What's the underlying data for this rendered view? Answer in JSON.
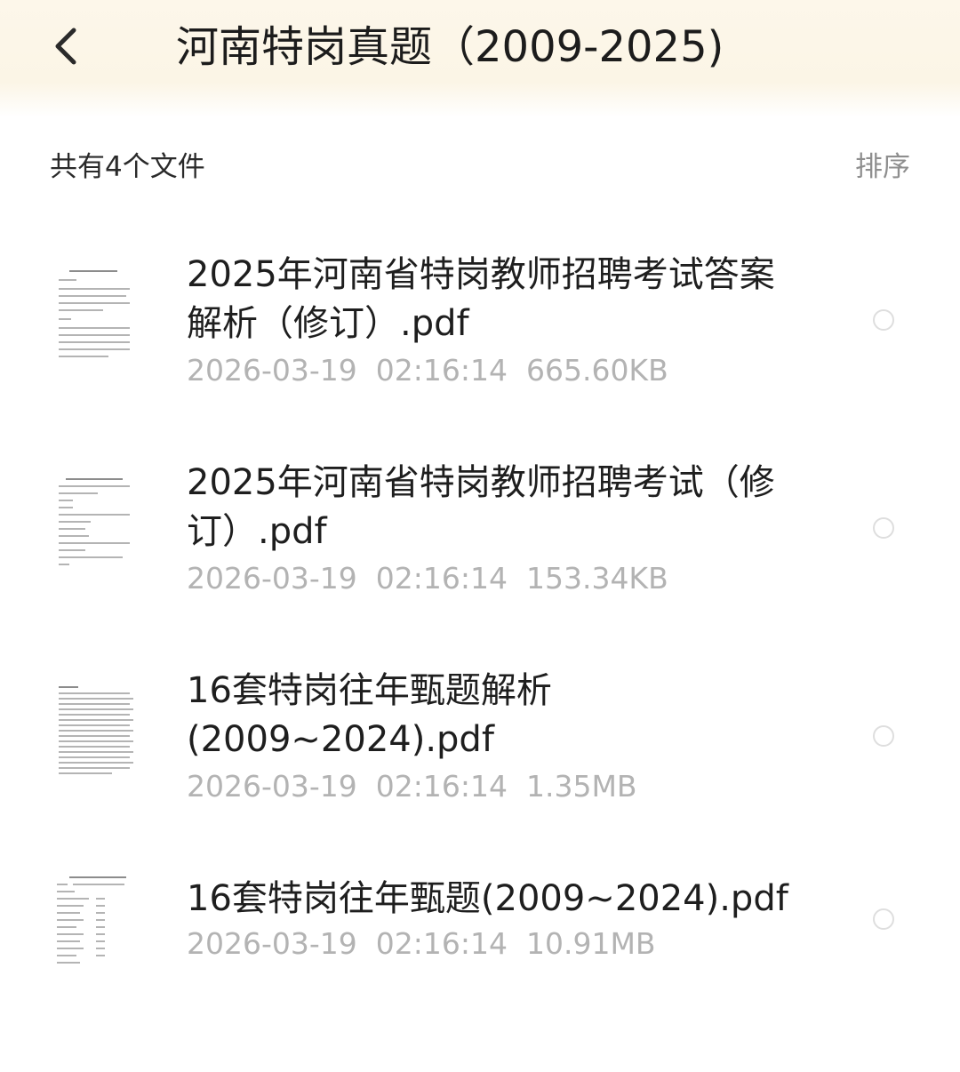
{
  "header": {
    "back_icon": "chevron-left-icon",
    "title": "河南特岗真题（2009-2025)"
  },
  "toolbar": {
    "count_label": "共有4个文件",
    "sort_label": "排序"
  },
  "files": [
    {
      "name": "2025年河南省特岗教师招聘考试答案解析（修订）.pdf",
      "date": "2026-03-19",
      "time": "02:16:14",
      "size": "665.60KB",
      "selected": false
    },
    {
      "name": "2025年河南省特岗教师招聘考试（修订）.pdf",
      "date": "2026-03-19",
      "time": "02:16:14",
      "size": "153.34KB",
      "selected": false
    },
    {
      "name": "16套特岗往年甄题解析(2009~2024).pdf",
      "date": "2026-03-19",
      "time": "02:16:14",
      "size": "1.35MB",
      "selected": false
    },
    {
      "name": "16套特岗往年甄题(2009~2024).pdf",
      "date": "2026-03-19",
      "time": "02:16:14",
      "size": "10.91MB",
      "selected": false
    }
  ]
}
